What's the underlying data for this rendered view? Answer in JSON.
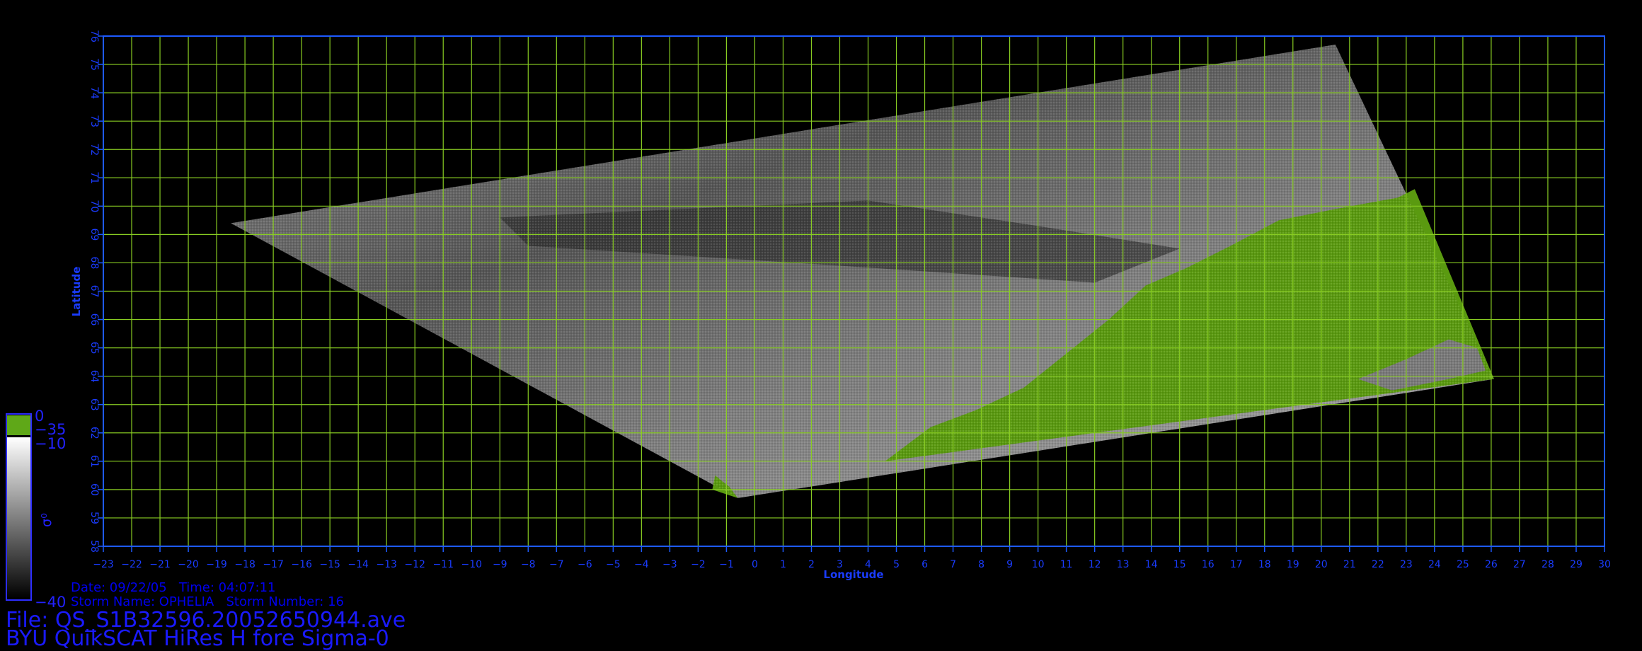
{
  "map": {
    "lon_range": [
      -23,
      30
    ],
    "lat_range": [
      58,
      76
    ],
    "lon_step": 1,
    "lat_step": 1,
    "xlabel": "Longitude",
    "ylabel": "Latitude",
    "grid": true,
    "frame_color": "#1e5aff",
    "grid_color": "#88cc22",
    "tick_color": "#1a3cff",
    "swath_corners": [
      {
        "lon": -18.5,
        "lat": 69.4
      },
      {
        "lon": 20.5,
        "lat": 75.7
      },
      {
        "lon": 26.1,
        "lat": 63.9
      },
      {
        "lon": -0.6,
        "lat": 59.7
      }
    ],
    "ice_region_color": "#5a9a10",
    "ocean_gradient": [
      "#3a3a3a",
      "#7a7a7a",
      "#a5a5a5"
    ]
  },
  "colorbar": {
    "max_label": "0",
    "top_label": "−35",
    "mid_label": "−10",
    "min_label": "−40",
    "symbol_label": "σ⁰",
    "green_color": "#5fa818",
    "gradient_top": "#ffffff",
    "gradient_bottom": "#000000"
  },
  "info": {
    "line1": "Date: 09/22/05   Time: 04:07:11",
    "line2": "Storm Name: OPHELIA   Storm Number: 16",
    "file_line": "File: QS_S1B32596.20052650944.ave",
    "product_line": "BYU QuikSCAT HiRes H fore Sigma-0"
  }
}
